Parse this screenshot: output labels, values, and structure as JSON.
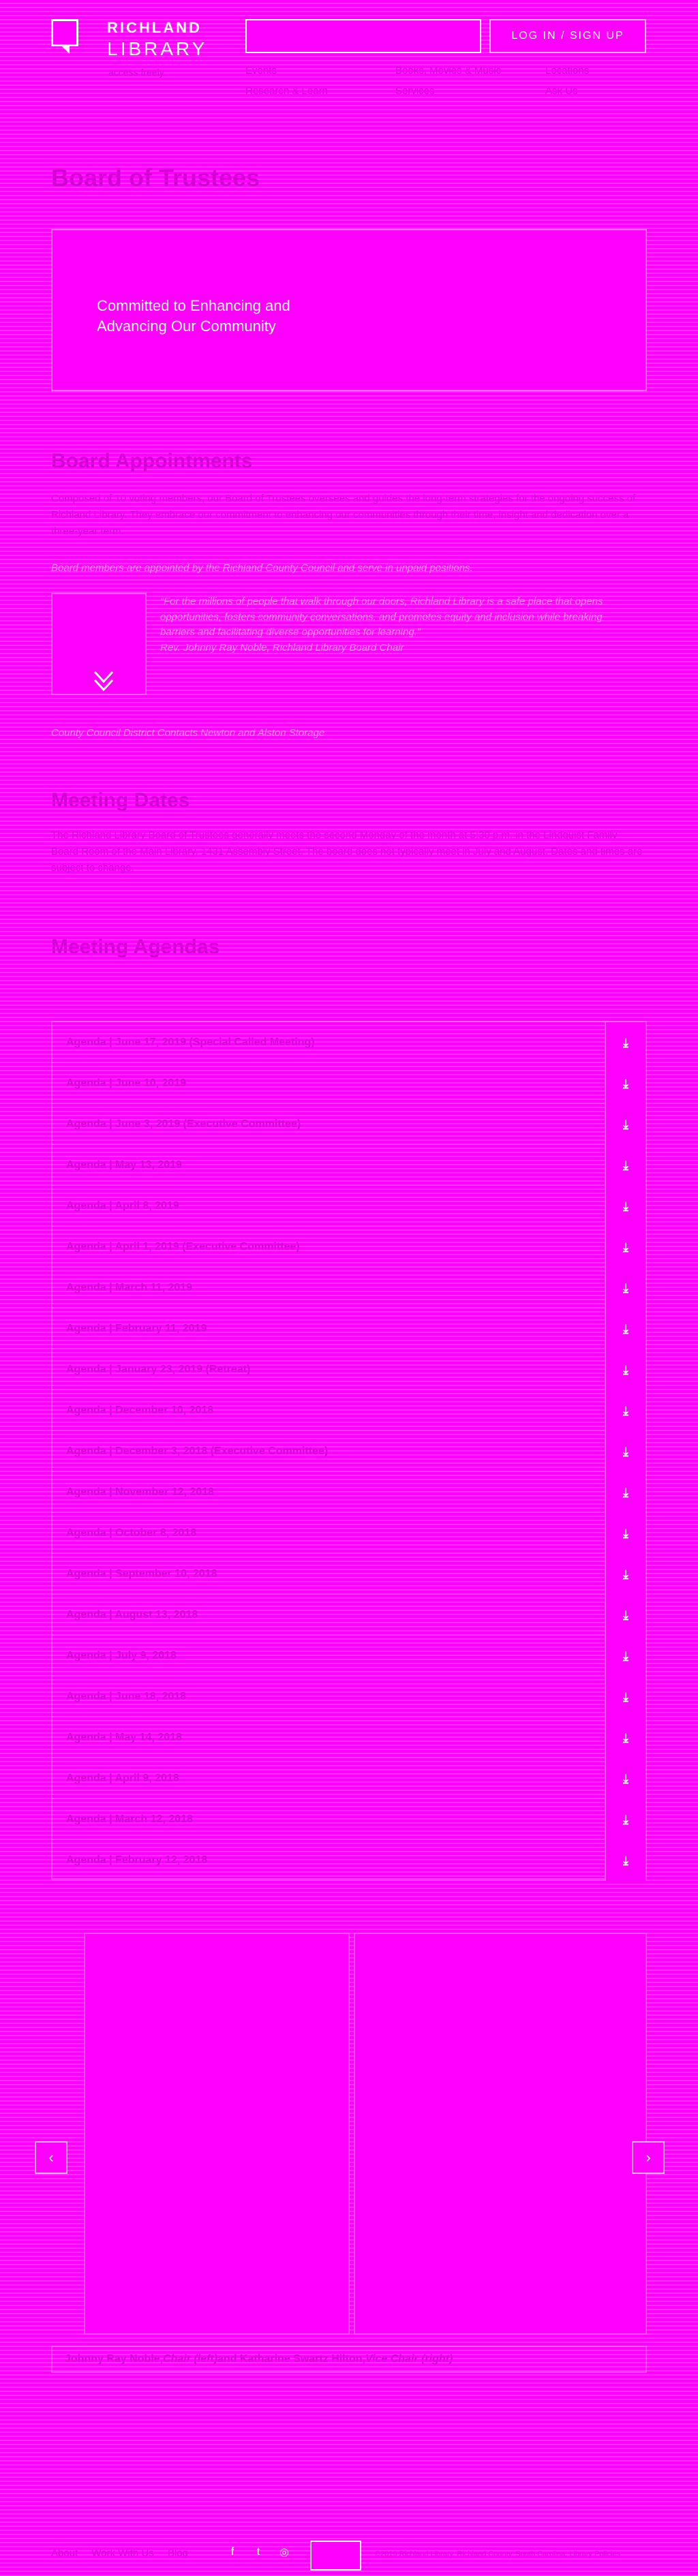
{
  "header": {
    "logo_line1": "RICHLAND",
    "logo_line2": "LIBRARY",
    "tagline": "access freely.",
    "search_placeholder": "",
    "login_label": "LOG IN / SIGN UP",
    "nav": [
      "Events",
      "Research & Learn",
      "Books, Movies & Music",
      "Services",
      "Locations",
      "Ask Us"
    ]
  },
  "page_title": "Board of Trustees",
  "hero": {
    "text": "Committed to Enhancing and Advancing Our Community"
  },
  "board_appointments": {
    "heading": "Board Appointments",
    "intro": "Composed of 10 voting members, our Board of Trustees oversees and guides the long-term strategies for the ongoing success of Richland Library. They embrace our commitment to enhancing our communities through their time, insight and dedication over a three-year term.",
    "note": "Board members are appointed by the Richland County Council and serve in unpaid positions.",
    "quote": "“For the millions of people that walk through our doors, Richland Library is a safe place that opens opportunities, fosters community conversations, and promotes equity and inclusion while breaking barriers and facilitating diverse opportunities for learning.”",
    "quote_attribution": "Rev. Johnny Ray Noble, Richland Library Board Chair",
    "council": "County Council District Contacts Newton and Alston Storage"
  },
  "meeting_dates": {
    "heading": "Meeting Dates",
    "text": "The Richland Library Board of Trustees generally meets the second Monday of the month at 5:30 p.m. in the Lindquist Family Board Room of the Main Library, 1431 Assembly Street. The board does not typically meet in July and August. Dates and times are subject to change."
  },
  "meeting_agendas": {
    "heading": "Meeting Agendas",
    "items": [
      "Agenda | June 17, 2019 (Special Called Meeting)",
      "Agenda | June 10, 2019",
      "Agenda | June 3, 2019 (Executive Committee)",
      "Agenda | May 13, 2019",
      "Agenda | April 8, 2019",
      "Agenda | April 1, 2019 (Executive Committee)",
      "Agenda | March 11, 2019",
      "Agenda | February 11, 2019",
      "Agenda | January 23, 2019 (Retreat)",
      "Agenda | December 10, 2018",
      "Agenda | December 3, 2018 (Executive Committee)",
      "Agenda | November 12, 2018",
      "Agenda | October 8, 2018",
      "Agenda | September 10, 2018",
      "Agenda | August 13, 2018",
      "Agenda | July 9, 2018",
      "Agenda | June 18, 2018",
      "Agenda | May 14, 2018",
      "Agenda | April 9, 2018",
      "Agenda | March 12, 2018",
      "Agenda | February 12, 2018"
    ]
  },
  "photo_caption": {
    "part1": "Johnny Ray Noble, ",
    "role1": "Chair (left)",
    "part2": " and Katharine Swartz Hilton, ",
    "role2": "Vice Chair (right)"
  },
  "footer": {
    "links": [
      "About",
      "Work With Us",
      "Blog"
    ],
    "copyright": "©2019 Richland Library. Richland County, South Carolina. Library Policies"
  }
}
